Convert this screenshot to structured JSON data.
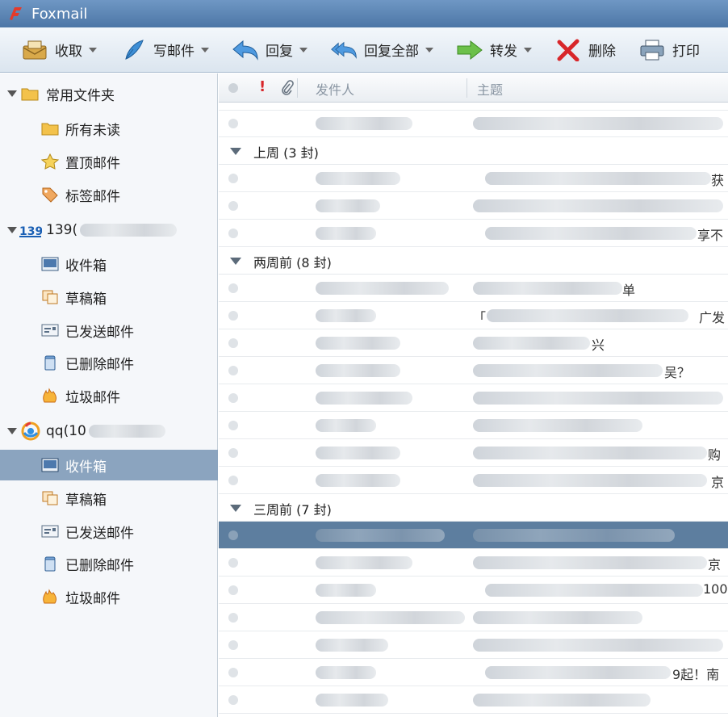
{
  "app": {
    "title": "Foxmail"
  },
  "toolbar": {
    "receive": "收取",
    "compose": "写邮件",
    "reply": "回复",
    "reply_all": "回复全部",
    "forward": "转发",
    "delete": "删除",
    "print": "打印"
  },
  "sidebar": {
    "favorites": {
      "label": "常用文件夹",
      "items": [
        "所有未读",
        "置顶邮件",
        "标签邮件"
      ]
    },
    "account1": {
      "label": "139(",
      "items": [
        "收件箱",
        "草稿箱",
        "已发送邮件",
        "已删除邮件",
        "垃圾邮件"
      ]
    },
    "account2": {
      "label": "qq(10",
      "items": [
        "收件箱",
        "草稿箱",
        "已发送邮件",
        "已删除邮件",
        "垃圾邮件"
      ],
      "selected": "收件箱"
    }
  },
  "list": {
    "columns": {
      "sender": "发件人",
      "subject": "主题"
    },
    "groups": [
      {
        "label": "上周 (3 封)"
      },
      {
        "label": "两周前 (8 封)"
      },
      {
        "label": "三周前 (7 封)"
      }
    ],
    "fragments": {
      "r1": "获",
      "r3": "享不",
      "g2r1": "单",
      "g2r2a": "「",
      "g2r2b": "广发",
      "g2r3": "兴",
      "g2r4": "吴？",
      "g2r7": "购",
      "g2r8": "京",
      "g3r2": "京",
      "g3r3": "100",
      "g3r6": "9起！南"
    }
  },
  "colors": {
    "accent": "#5d7e9f",
    "titlebar": "#4c76a6"
  },
  "icons": [
    "foxmail-logo-icon",
    "receive-icon",
    "compose-icon",
    "reply-icon",
    "reply-all-icon",
    "forward-icon",
    "delete-icon",
    "print-icon",
    "folder-icon",
    "star-icon",
    "tag-icon",
    "inbox-icon",
    "drafts-icon",
    "sent-icon",
    "trash-icon",
    "junk-icon"
  ]
}
